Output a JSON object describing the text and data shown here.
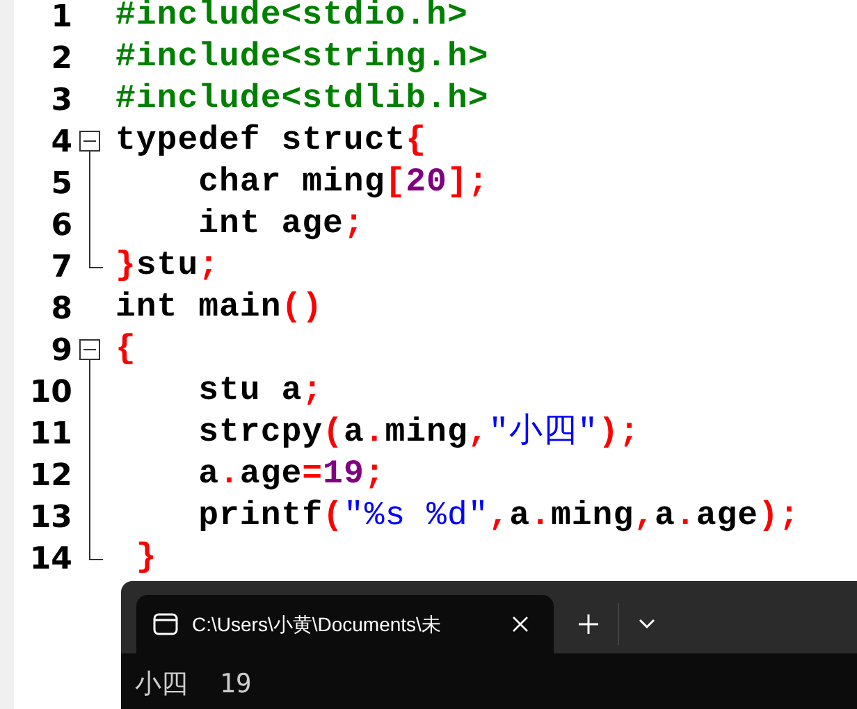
{
  "editor": {
    "lines": [
      {
        "number": "1",
        "kind": "plain",
        "tokens": [
          {
            "kind": "preproc",
            "text": "#include<stdio.h>"
          }
        ]
      },
      {
        "number": "2",
        "kind": "plain",
        "tokens": [
          {
            "kind": "preproc",
            "text": "#include<string.h>"
          }
        ]
      },
      {
        "number": "3",
        "kind": "plain",
        "tokens": [
          {
            "kind": "preproc",
            "text": "#include<stdlib.h>"
          }
        ]
      },
      {
        "number": "4",
        "kind": "start",
        "tokens": [
          {
            "kind": "plain",
            "text": "typedef struct"
          },
          {
            "kind": "punct",
            "text": "{"
          }
        ]
      },
      {
        "number": "5",
        "kind": "body",
        "tokens": [
          {
            "kind": "plain",
            "text": "    char ming"
          },
          {
            "kind": "punct",
            "text": "["
          },
          {
            "kind": "number",
            "text": "20"
          },
          {
            "kind": "punct",
            "text": "];"
          }
        ]
      },
      {
        "number": "6",
        "kind": "body",
        "tokens": [
          {
            "kind": "plain",
            "text": "    int age"
          },
          {
            "kind": "punct",
            "text": ";"
          }
        ]
      },
      {
        "number": "7",
        "kind": "end",
        "tokens": [
          {
            "kind": "punct",
            "text": "}"
          },
          {
            "kind": "plain",
            "text": "stu"
          },
          {
            "kind": "punct",
            "text": ";"
          }
        ]
      },
      {
        "number": "8",
        "kind": "plain",
        "tokens": [
          {
            "kind": "plain",
            "text": "int main"
          },
          {
            "kind": "punct",
            "text": "()"
          }
        ]
      },
      {
        "number": "9",
        "kind": "start",
        "tokens": [
          {
            "kind": "punct",
            "text": "{"
          }
        ]
      },
      {
        "number": "10",
        "kind": "body",
        "tokens": [
          {
            "kind": "plain",
            "text": "    stu a"
          },
          {
            "kind": "punct",
            "text": ";"
          }
        ]
      },
      {
        "number": "11",
        "kind": "body",
        "tokens": [
          {
            "kind": "plain",
            "text": "    strcpy"
          },
          {
            "kind": "punct",
            "text": "("
          },
          {
            "kind": "plain",
            "text": "a"
          },
          {
            "kind": "punct",
            "text": "."
          },
          {
            "kind": "plain",
            "text": "ming"
          },
          {
            "kind": "punct",
            "text": ","
          },
          {
            "kind": "string",
            "text": "\"小四\""
          },
          {
            "kind": "punct",
            "text": ");"
          }
        ]
      },
      {
        "number": "12",
        "kind": "body",
        "tokens": [
          {
            "kind": "plain",
            "text": "    a"
          },
          {
            "kind": "punct",
            "text": "."
          },
          {
            "kind": "plain",
            "text": "age"
          },
          {
            "kind": "punct",
            "text": "="
          },
          {
            "kind": "number",
            "text": "19"
          },
          {
            "kind": "punct",
            "text": ";"
          }
        ]
      },
      {
        "number": "13",
        "kind": "body",
        "tokens": [
          {
            "kind": "plain",
            "text": "    printf"
          },
          {
            "kind": "punct",
            "text": "("
          },
          {
            "kind": "string",
            "text": "\"%s %d\""
          },
          {
            "kind": "punct",
            "text": ","
          },
          {
            "kind": "plain",
            "text": "a"
          },
          {
            "kind": "punct",
            "text": "."
          },
          {
            "kind": "plain",
            "text": "ming"
          },
          {
            "kind": "punct",
            "text": ","
          },
          {
            "kind": "plain",
            "text": "a"
          },
          {
            "kind": "punct",
            "text": "."
          },
          {
            "kind": "plain",
            "text": "age"
          },
          {
            "kind": "punct",
            "text": ");"
          }
        ]
      },
      {
        "number": "14",
        "kind": "end",
        "tokens": [
          {
            "kind": "punct",
            "text": " }"
          }
        ]
      }
    ]
  },
  "terminal": {
    "tab": {
      "title": "C:\\Users\\小黄\\Documents\\未",
      "selected": true
    },
    "output": "小四  19"
  }
}
